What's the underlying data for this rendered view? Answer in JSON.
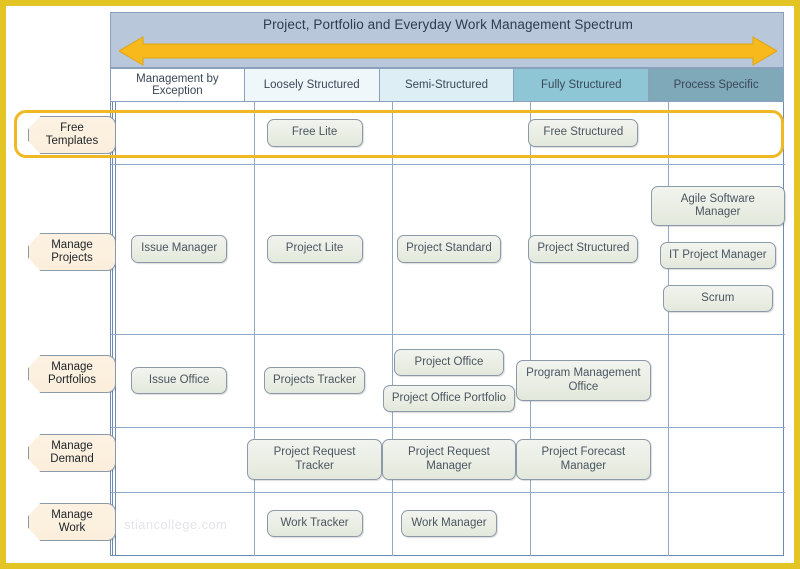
{
  "frame": {
    "border_color": "#e2c424",
    "highlight_color": "#f0b823"
  },
  "title": {
    "text": "Project, Portfolio and Everyday Work Management Spectrum",
    "band_color": "#b9c7da",
    "arrow_color": "#f5b21a",
    "arrow_name": "double-headed-spectrum-arrow"
  },
  "columns": [
    {
      "label": "Management by Exception",
      "color": "#ffffff"
    },
    {
      "label": "Loosely Structured",
      "color": "#eff7fb"
    },
    {
      "label": "Semi-Structured",
      "color": "#ddeef4"
    },
    {
      "label": "Fully Structured",
      "color": "#8ec6d6"
    },
    {
      "label": "Process Specific",
      "color": "#7fa8b8"
    }
  ],
  "rows": [
    {
      "label": "Free\nTemplates",
      "label_line1": "Free",
      "label_line2": "Templates",
      "highlighted": true,
      "cells": [
        [],
        [
          "Free Lite"
        ],
        [],
        [
          "Free Structured"
        ],
        []
      ]
    },
    {
      "label_line1": "Manage",
      "label_line2": "Projects",
      "highlighted": false,
      "cells": [
        [
          "Issue Manager"
        ],
        [
          "Project Lite"
        ],
        [
          "Project Standard"
        ],
        [
          "Project Structured"
        ],
        [
          "Agile Software Manager",
          "IT Project Manager",
          "Scrum"
        ]
      ]
    },
    {
      "label_line1": "Manage",
      "label_line2": "Portfolios",
      "highlighted": false,
      "cells": [
        [
          "Issue Office"
        ],
        [
          "Projects Tracker"
        ],
        [
          "Project Office",
          "Project Office Portfolio"
        ],
        [
          "Program Management Office"
        ],
        []
      ]
    },
    {
      "label_line1": "Manage",
      "label_line2": "Demand",
      "highlighted": false,
      "cells": [
        [],
        [
          "Project Request Tracker"
        ],
        [
          "Project Request Manager"
        ],
        [
          "Project Forecast Manager"
        ],
        []
      ]
    },
    {
      "label_line1": "Manage",
      "label_line2": "Work",
      "highlighted": false,
      "cells": [
        [],
        [
          "Work Tracker"
        ],
        [
          "Work Manager"
        ],
        [],
        []
      ]
    }
  ],
  "watermark": {
    "text": "stiancollege.com"
  }
}
